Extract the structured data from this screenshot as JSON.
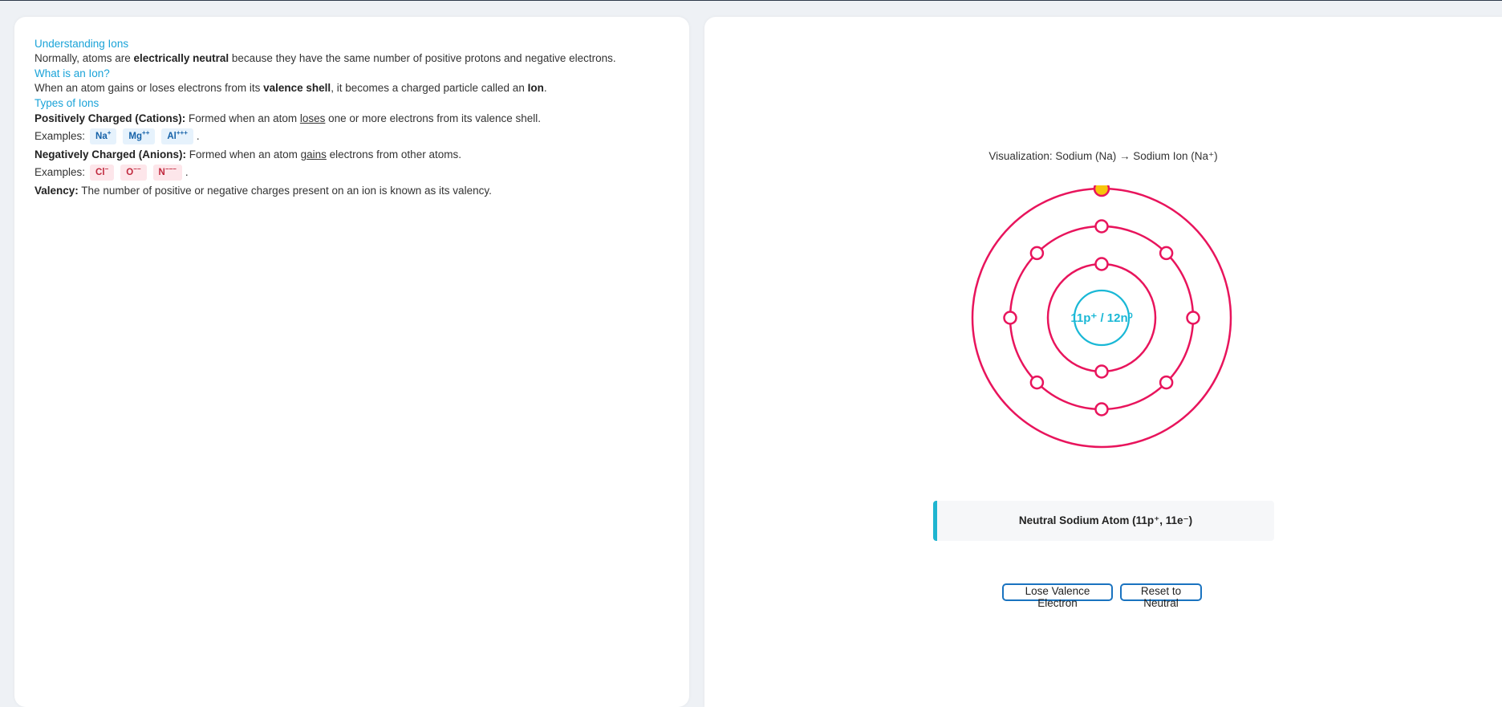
{
  "left": {
    "h1": "Understanding Ions",
    "intro": {
      "a": "Normally, atoms are ",
      "b": "electrically neutral",
      "c": " because they have the same number of positive protons and negative electrons."
    },
    "h2": "What is an Ion?",
    "ion_def": {
      "a": "When an atom gains or loses electrons from its ",
      "b": "valence shell",
      "c": ", it becomes a charged particle called an ",
      "d": "Ion",
      "e": "."
    },
    "h3": "Types of Ions",
    "cation": {
      "label": "Positively Charged (Cations):",
      "a": " Formed when an atom ",
      "u": "loses",
      "b": " one or more electrons from its valence shell."
    },
    "examples_label": "Examples:",
    "cation_examples": [
      {
        "sym": "Na",
        "charge": "+"
      },
      {
        "sym": "Mg",
        "charge": "++"
      },
      {
        "sym": "Al",
        "charge": "+++"
      }
    ],
    "anion": {
      "label": "Negatively Charged (Anions):",
      "a": " Formed when an atom ",
      "u": "gains",
      "b": " electrons from other atoms."
    },
    "anion_examples": [
      {
        "sym": "Cl",
        "charge": "−"
      },
      {
        "sym": "O",
        "charge": "−−"
      },
      {
        "sym": "N",
        "charge": "−−−"
      }
    ],
    "period": ".",
    "valency": {
      "label": "Valency:",
      "text": " The number of positive or negative charges present on an ion is known as its valency."
    }
  },
  "right": {
    "viz_title": "Visualization: Sodium (Na) → Sodium Ion (Na⁺)",
    "nucleus_label": "11p⁺ / 12n⁰",
    "shells": [
      {
        "electrons": 2
      },
      {
        "electrons": 8
      },
      {
        "electrons": 1,
        "valence": true
      }
    ],
    "status": "Neutral Sodium Atom (11p⁺, 11e⁻)",
    "buttons": {
      "lose": "Lose Valence Electron",
      "reset": "Reset to Neutral"
    },
    "colors": {
      "shell": "#e8145c",
      "nucleus": "#1ab8d6",
      "electron_fill": "#ffffff",
      "valence_fill": "#f7c50a",
      "accent": "#1aa3d8"
    }
  }
}
